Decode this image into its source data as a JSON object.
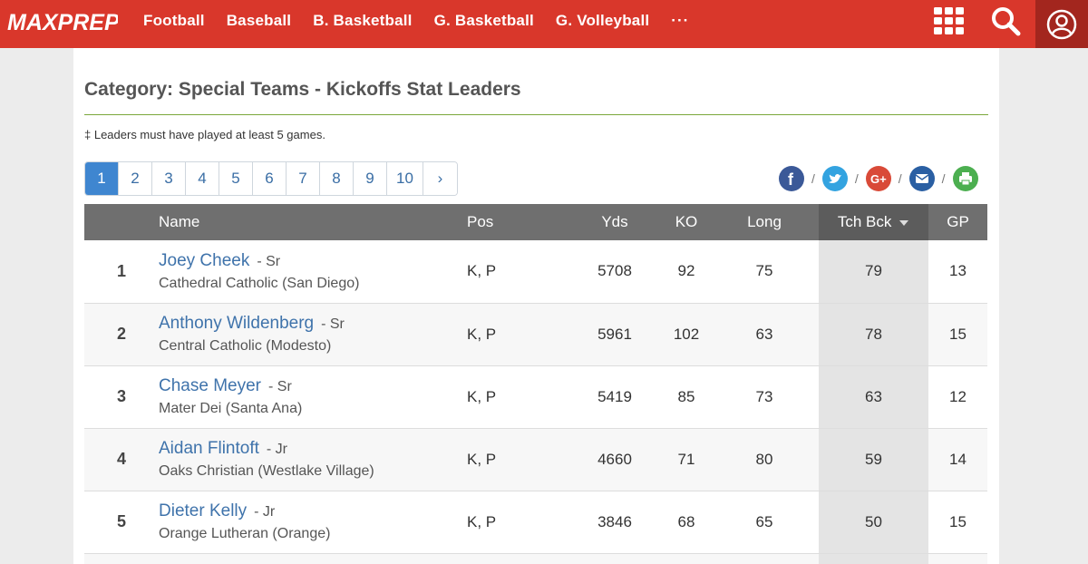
{
  "header": {
    "brand": "MAXPREPS",
    "nav": [
      "Football",
      "Baseball",
      "B. Basketball",
      "G. Basketball",
      "G. Volleyball"
    ],
    "more": "···",
    "colors": {
      "bar": "#d9372b",
      "user_bg": "#a3261e"
    }
  },
  "page": {
    "title": "Category: Special Teams - Kickoffs Stat Leaders",
    "note": "‡ Leaders must have played at least 5 games."
  },
  "pagination": {
    "pages": [
      "1",
      "2",
      "3",
      "4",
      "5",
      "6",
      "7",
      "8",
      "9",
      "10"
    ],
    "next": "›",
    "active": "1"
  },
  "share": {
    "icons": [
      "facebook-icon",
      "twitter-icon",
      "google-plus-icon",
      "email-icon",
      "print-icon"
    ],
    "separator": "/"
  },
  "table": {
    "headers": {
      "rank": "",
      "name": "Name",
      "pos": "Pos",
      "yds": "Yds",
      "ko": "KO",
      "long": "Long",
      "tchbck": "Tch Bck",
      "gp": "GP"
    },
    "sorted_column": "tchbck",
    "rows": [
      {
        "rank": "1",
        "name": "Joey Cheek",
        "year": "- Sr",
        "school": "Cathedral Catholic (San Diego)",
        "pos": "K, P",
        "yds": "5708",
        "ko": "92",
        "long": "75",
        "tchbck": "79",
        "gp": "13"
      },
      {
        "rank": "2",
        "name": "Anthony Wildenberg",
        "year": "- Sr",
        "school": "Central Catholic (Modesto)",
        "pos": "K, P",
        "yds": "5961",
        "ko": "102",
        "long": "63",
        "tchbck": "78",
        "gp": "15"
      },
      {
        "rank": "3",
        "name": "Chase Meyer",
        "year": "- Sr",
        "school": "Mater Dei (Santa Ana)",
        "pos": "K, P",
        "yds": "5419",
        "ko": "85",
        "long": "73",
        "tchbck": "63",
        "gp": "12"
      },
      {
        "rank": "4",
        "name": "Aidan Flintoft",
        "year": "- Jr",
        "school": "Oaks Christian (Westlake Village)",
        "pos": "K, P",
        "yds": "4660",
        "ko": "71",
        "long": "80",
        "tchbck": "59",
        "gp": "14"
      },
      {
        "rank": "5",
        "name": "Dieter Kelly",
        "year": "- Jr",
        "school": "Orange Lutheran (Orange)",
        "pos": "K, P",
        "yds": "3846",
        "ko": "68",
        "long": "65",
        "tchbck": "50",
        "gp": "15"
      }
    ]
  }
}
